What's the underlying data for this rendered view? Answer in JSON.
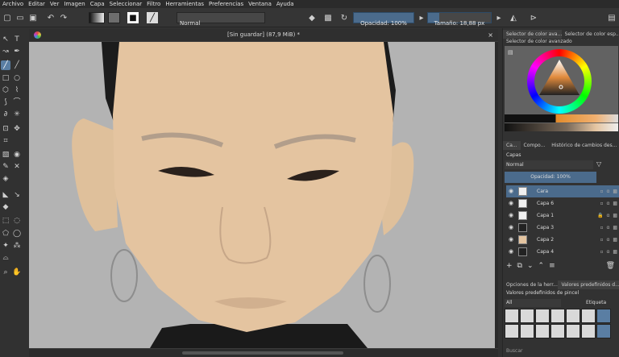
{
  "menu": [
    "Archivo",
    "Editar",
    "Ver",
    "Imagen",
    "Capa",
    "Seleccionar",
    "Filtro",
    "Herramientas",
    "Preferencias",
    "Ventana",
    "Ayuda"
  ],
  "toolbar": {
    "blend_mode": "Normal",
    "opacity": "Opacidad: 100%",
    "size": "Tamaño: 18,88 px"
  },
  "document": {
    "tab_title": "[Sin guardar]  (87,9 MiB) *",
    "close_glyph": "×"
  },
  "dock": {
    "color_tabs": [
      "Selector de color ava...",
      "Selector de color esp..."
    ],
    "advanced_selector_title": "Selector de color avanzado",
    "panel_tabs": [
      "Ca...",
      "Compo...",
      "Histórico de cambios des..."
    ],
    "layers_title": "Capas",
    "blend_mode": "Normal",
    "opacity": "Opacidad:  100%",
    "layers": [
      {
        "name": "Cara",
        "selected": true,
        "locked": false
      },
      {
        "name": "Capa 6",
        "selected": false,
        "locked": false
      },
      {
        "name": "Capa 1",
        "selected": false,
        "locked": true
      },
      {
        "name": "Capa 3",
        "selected": false,
        "locked": false
      },
      {
        "name": "Capa 2",
        "selected": false,
        "locked": false
      },
      {
        "name": "Capa 4",
        "selected": false,
        "locked": false
      }
    ],
    "bottom_tabs": [
      "Opciones de la herr...",
      "Valores predefinidos d..."
    ],
    "presets_title": "Valores predefinidos de pincel",
    "presets_filter": "All",
    "presets_tag": "Etiqueta",
    "search_placeholder": "Buscar"
  },
  "colors": {
    "accent": "#4b6b8c",
    "skin": "#e4c4a0",
    "hair": "#1d1d1d",
    "background_canvas": "#b3b3b3"
  }
}
